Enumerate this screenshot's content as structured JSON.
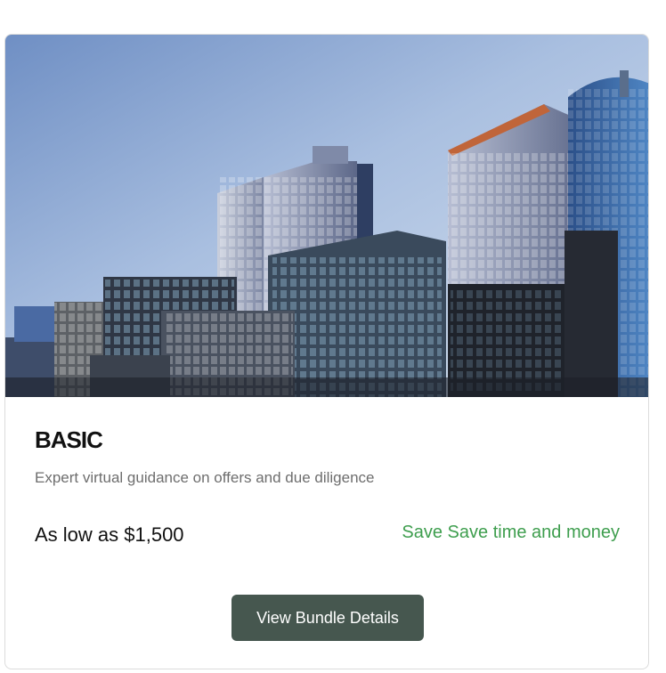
{
  "card": {
    "image_alt": "City skyline with glass office towers",
    "title": "BASIC",
    "description": "Expert virtual guidance on offers and due diligence",
    "price": "As low as $1,500",
    "savings": "Save Save time and money",
    "button_label": "View Bundle Details"
  },
  "colors": {
    "savings_text": "#3e9e4e",
    "button_bg": "#46574f",
    "description_text": "#6e6e6e"
  }
}
